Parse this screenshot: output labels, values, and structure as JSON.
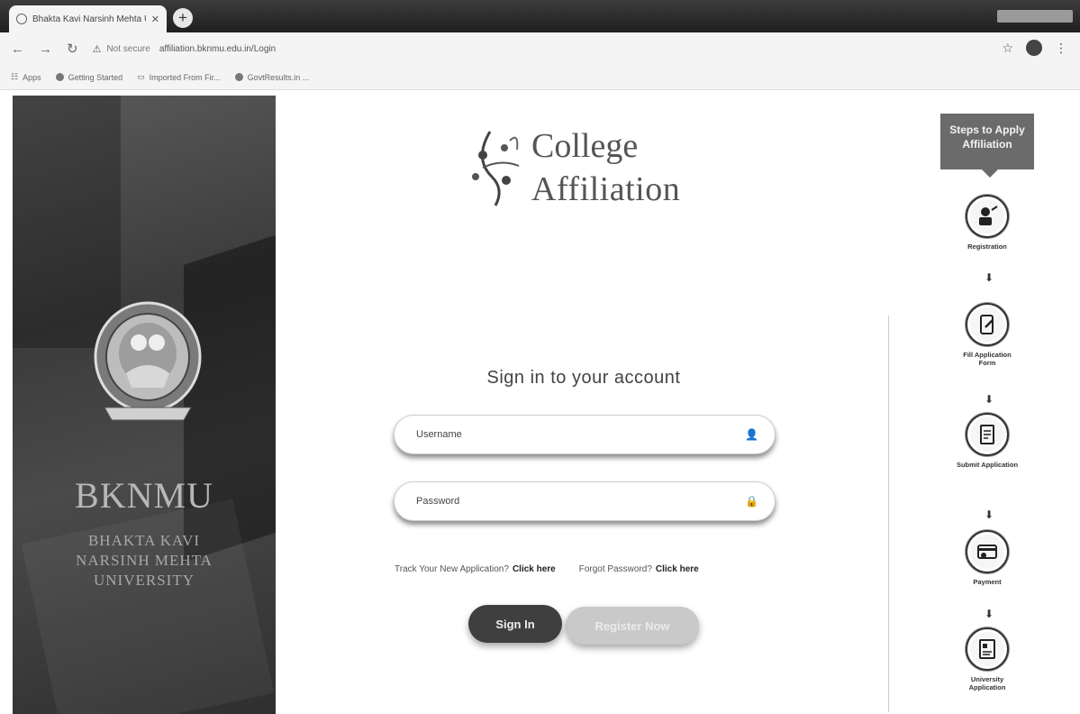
{
  "browser": {
    "tab_title": "Bhakta Kavi Narsinh Mehta Uni",
    "new_tab": "+",
    "address_security": "Not secure",
    "address_url": "affiliation.bknmu.edu.in/Login",
    "bookmarks": [
      "Apps",
      "Getting Started",
      "Imported From Fir...",
      "GovtResults.in ..."
    ]
  },
  "brand": {
    "short_name": "BKNMU",
    "full_name_lines": [
      "BHAKTA KAVI",
      "NARSINH MEHTA",
      "UNIVERSITY"
    ]
  },
  "logo": {
    "line1": "College",
    "line2": "Affiliation"
  },
  "login": {
    "title": "Sign in to your account",
    "username_placeholder": "Username",
    "password_placeholder": "Password",
    "track_text": "Track Your New Application?",
    "track_link": "Click here",
    "forgot_text": "Forgot Password?",
    "forgot_link": "Click here",
    "signin_label": "Sign In",
    "register_label": "Register Now"
  },
  "steps": {
    "title_line1": "Steps to Apply",
    "title_line2": "Affiliation",
    "items": [
      {
        "label": "Registration",
        "icon": "user-register-icon"
      },
      {
        "label": "Fill Application Form",
        "icon": "form-edit-icon"
      },
      {
        "label": "Submit Application",
        "icon": "document-submit-icon"
      },
      {
        "label": "Payment",
        "icon": "payment-card-icon"
      },
      {
        "label": "University Application",
        "icon": "university-application-icon"
      }
    ],
    "arrow": "⬇"
  }
}
